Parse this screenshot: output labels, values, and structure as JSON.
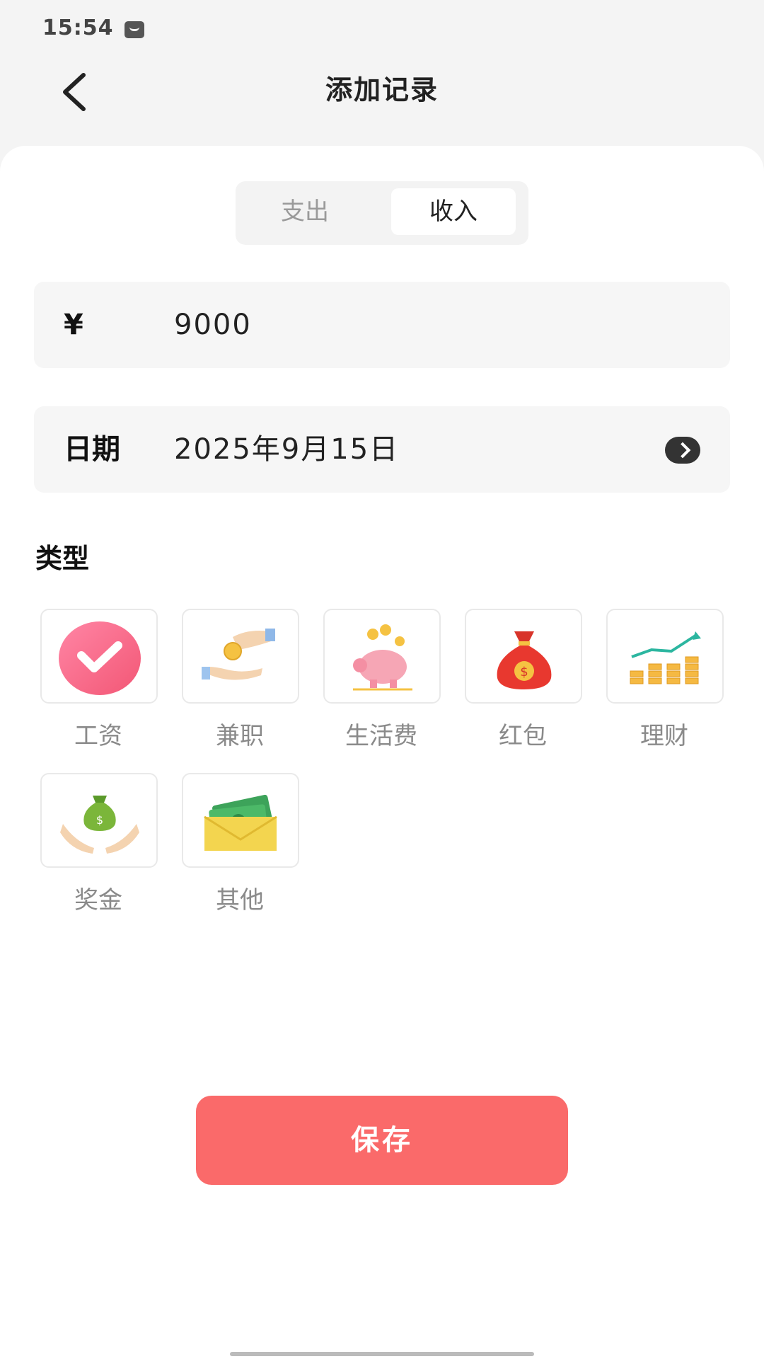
{
  "status_bar": {
    "time": "15:54"
  },
  "header": {
    "title": "添加记录"
  },
  "tabs": {
    "expense": "支出",
    "income": "收入",
    "selected": "收入"
  },
  "amount": {
    "currency_symbol": "¥",
    "value": "9000"
  },
  "date": {
    "label": "日期",
    "value": "2025年9月15日"
  },
  "category_section": {
    "title": "类型"
  },
  "categories": [
    {
      "label": "工资",
      "icon": "check-badge-icon",
      "selected": true
    },
    {
      "label": "兼职",
      "icon": "hand-coin-icon",
      "selected": false
    },
    {
      "label": "生活费",
      "icon": "piggy-bank-icon",
      "selected": false
    },
    {
      "label": "红包",
      "icon": "red-money-bag-icon",
      "selected": false
    },
    {
      "label": "理财",
      "icon": "investment-chart-icon",
      "selected": false
    },
    {
      "label": "奖金",
      "icon": "money-bag-hands-icon",
      "selected": false
    },
    {
      "label": "其他",
      "icon": "cash-envelope-icon",
      "selected": false
    }
  ],
  "actions": {
    "save_label": "保存"
  },
  "colors": {
    "accent": "#fa6a6a",
    "selected_badge": "#f9577a"
  }
}
